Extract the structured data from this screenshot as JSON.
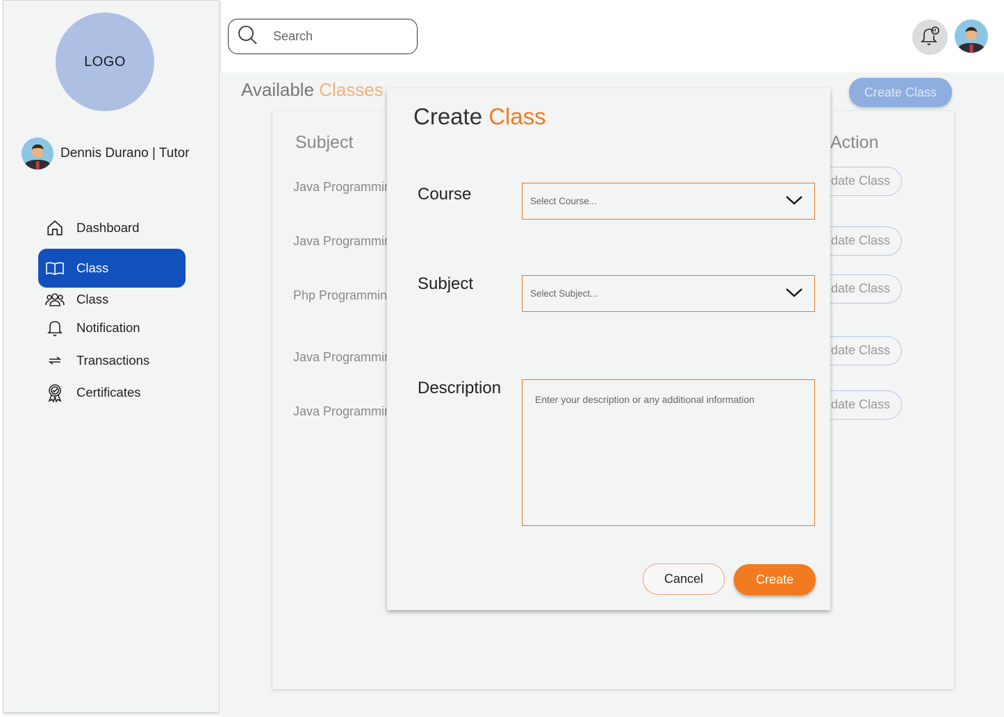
{
  "sidebar": {
    "logo_text": "LOGO",
    "user_name": "Dennis Durano | Tutor",
    "nav": [
      {
        "label": "Dashboard",
        "icon": "home-icon",
        "active": false
      },
      {
        "label": "Class",
        "icon": "book-icon",
        "active": true
      },
      {
        "label": "Class",
        "icon": "users-icon",
        "active": false
      },
      {
        "label": "Notification",
        "icon": "bell-icon",
        "active": false
      },
      {
        "label": "Transactions",
        "icon": "transfer-arrows-icon",
        "active": false
      },
      {
        "label": "Certificates",
        "icon": "certificate-badge-icon",
        "active": false
      }
    ]
  },
  "header": {
    "search_placeholder": "Search",
    "notification_icon": "bell-alert-icon",
    "profile_icon": "avatar"
  },
  "page": {
    "title_main": "Available ",
    "title_accent": "Classes",
    "create_button": "Create Class",
    "columns": {
      "subject": "Subject",
      "action": "Action"
    },
    "rows": [
      {
        "subject": "Java Programming",
        "action": "Update Class"
      },
      {
        "subject": "Java Programming",
        "action": "Update Class"
      },
      {
        "subject": "Php Programming",
        "action": "Update Class"
      },
      {
        "subject": "Java Programming",
        "action": "Update Class"
      },
      {
        "subject": "Java Programming",
        "action": "Update Class"
      }
    ]
  },
  "modal": {
    "title_main": "Create ",
    "title_accent": "Class",
    "course_label": "Course",
    "course_placeholder": "Select Course...",
    "subject_label": "Subject",
    "subject_placeholder": "Select Subject...",
    "description_label": "Description",
    "description_placeholder": "Enter your description or any additional information",
    "cancel_label": "Cancel",
    "create_label": "Create"
  },
  "colors": {
    "primary_blue": "#1150bd",
    "accent_orange": "#f27b1f",
    "logo_bg": "#adc0e4",
    "background": "#f3f4f4"
  }
}
